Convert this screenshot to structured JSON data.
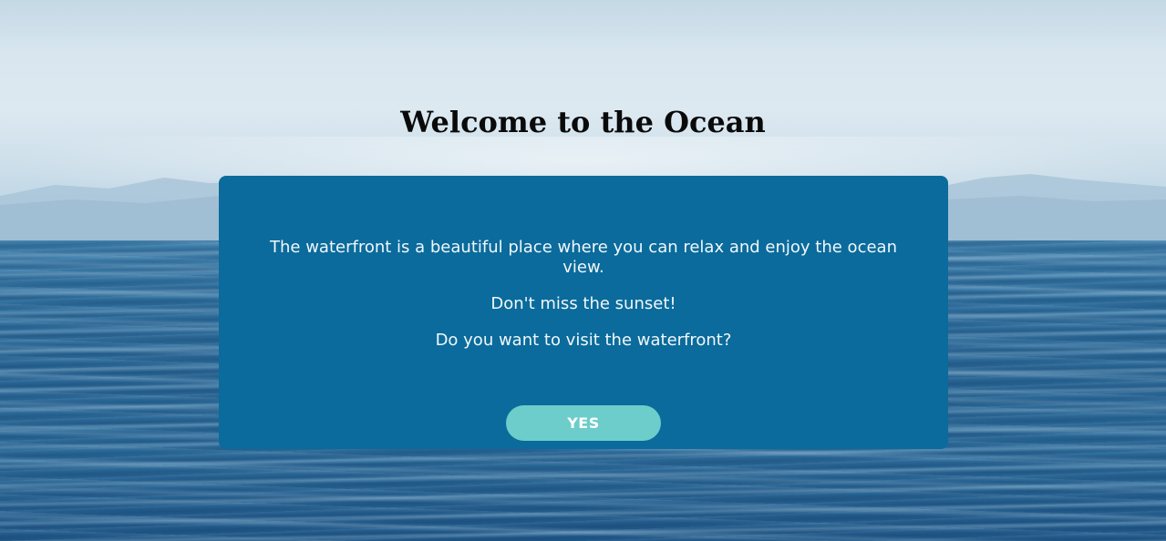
{
  "header": {
    "title": "Welcome to the Ocean"
  },
  "dialog": {
    "paragraphs": [
      "The waterfront is a beautiful place where you can relax and enjoy the ocean view.",
      "Don't miss the sunset!",
      "Do you want to visit the waterfront?"
    ],
    "yes_label": "YES"
  },
  "colors": {
    "card_background": "#0a6b9c",
    "button_background": "#6dcdca",
    "title_text": "#0a0a0a",
    "card_text": "#f2f7fa"
  }
}
